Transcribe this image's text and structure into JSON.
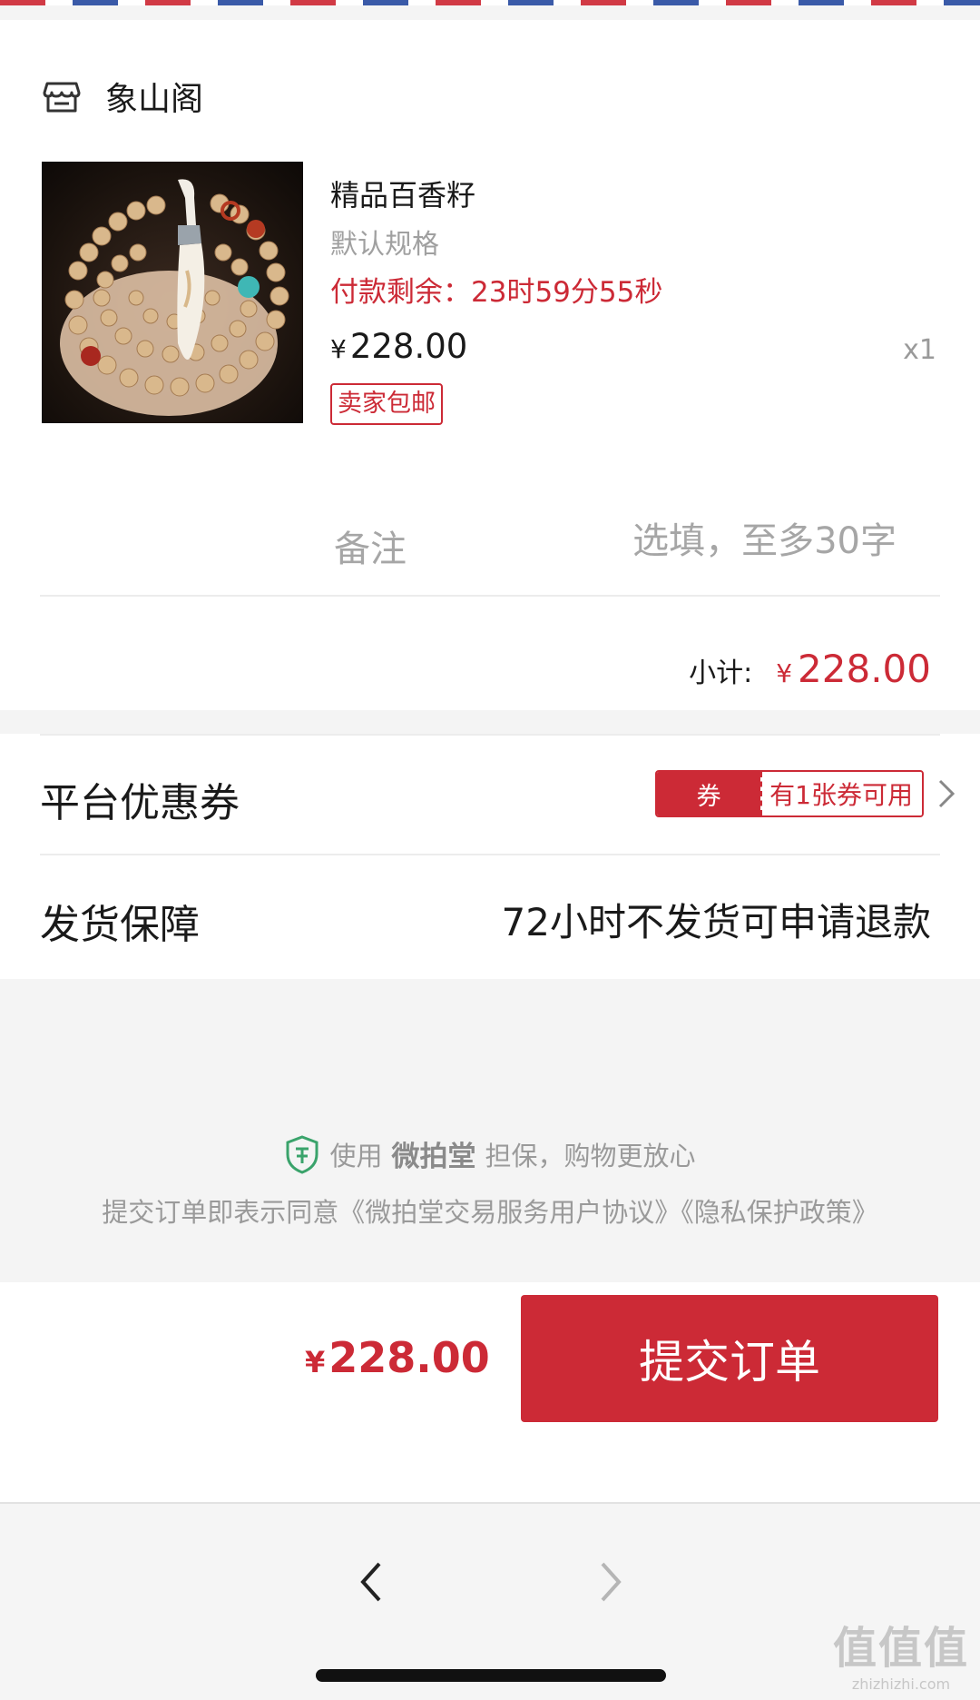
{
  "shop": {
    "name": "象山阁",
    "icon": "store-icon"
  },
  "product": {
    "title": "精品百香籽",
    "spec": "默认规格",
    "timer_label": "付款剩余：",
    "timer_value": "23时59分55秒",
    "currency": "¥",
    "price": "228.00",
    "quantity": "x1",
    "shipping_tag": "卖家包邮"
  },
  "remark": {
    "label": "备注",
    "placeholder": "选填，至多30字"
  },
  "subtotal": {
    "label": "小计:",
    "currency": "¥",
    "amount": "228.00"
  },
  "coupon": {
    "label": "平台优惠券",
    "badge_tag": "券",
    "badge_text": "有1张券可用"
  },
  "shipping_guarantee": {
    "label": "发货保障",
    "value": "72小时不发货可申请退款"
  },
  "guarantee": {
    "prefix": "使用",
    "brand": "微拍堂",
    "suffix": "担保，购物更放心",
    "agreement": "提交订单即表示同意《微拍堂交易服务用户协议》《隐私保护政策》"
  },
  "footer": {
    "currency": "¥",
    "total": "228.00",
    "submit_label": "提交订单"
  },
  "watermark": {
    "big": "值值值",
    "small": "zhizhizhi.com"
  },
  "colors": {
    "accent": "#cc2a36",
    "muted_text": "#a0a0a0",
    "background": "#f4f4f4"
  }
}
